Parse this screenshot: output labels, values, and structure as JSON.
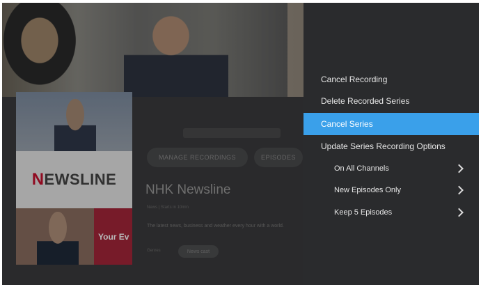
{
  "show": {
    "brand_logo_text": "NEWSLINE",
    "badge_text": "Your Ev",
    "buttons": [
      "MANAGE RECORDINGS",
      "EPISODES"
    ],
    "title": "NHK Newsline",
    "meta": "News | Starts in 10min",
    "description": "The latest news, business and weather every hour with a world.",
    "genre_label": "Genres",
    "genre_chip": "News cast"
  },
  "menu": {
    "items": [
      {
        "label": "Cancel Recording",
        "selected": false
      },
      {
        "label": "Delete Recorded Series",
        "selected": false
      },
      {
        "label": "Cancel Series",
        "selected": true
      },
      {
        "label": "Update Series Recording Options",
        "selected": false
      }
    ],
    "options": [
      {
        "label": "On All Channels",
        "icon": "chevron-right-icon"
      },
      {
        "label": "New Episodes Only",
        "icon": "chevron-right-icon"
      },
      {
        "label": "Keep 5 Episodes",
        "icon": "chevron-right-icon"
      }
    ]
  },
  "colors": {
    "accent": "#3aa0ea",
    "panel_bg": "#2a2b2d",
    "brand_red": "#c8102e"
  }
}
